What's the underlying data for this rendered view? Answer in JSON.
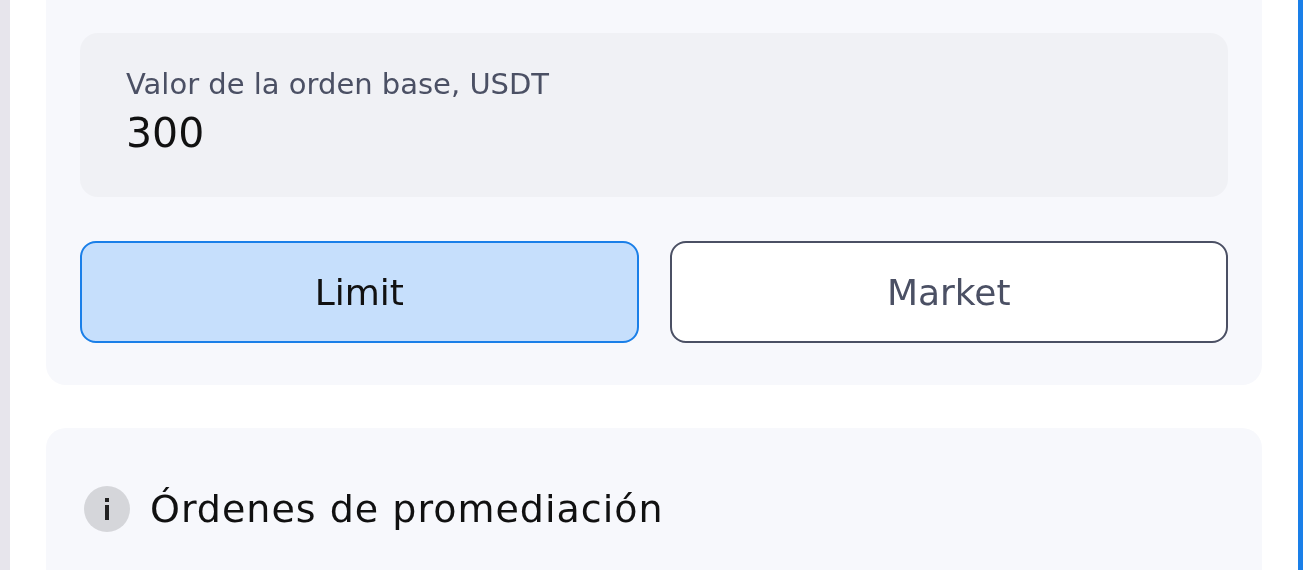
{
  "base_order": {
    "label": "Valor de la orden base, USDT",
    "value": "300"
  },
  "order_types": [
    {
      "label": "Limit",
      "selected": true
    },
    {
      "label": "Market",
      "selected": false
    }
  ],
  "averaging_section": {
    "title": "Órdenes de promediación"
  }
}
